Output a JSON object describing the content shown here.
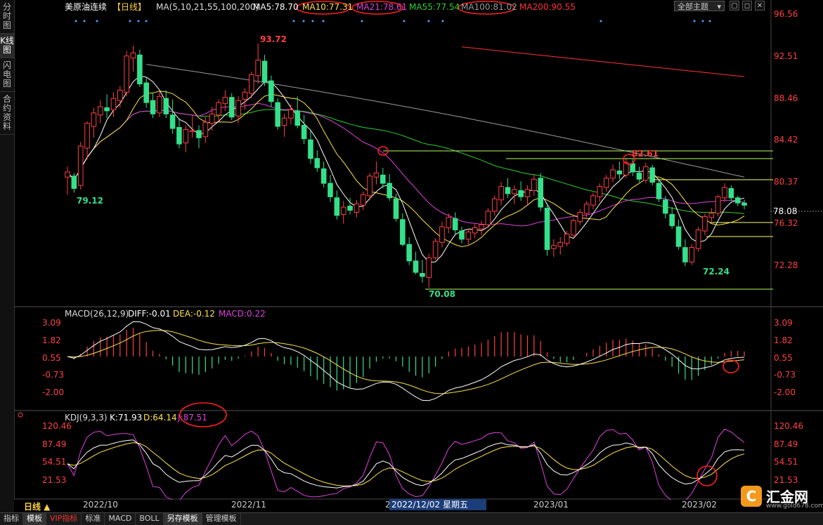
{
  "sidebar": {
    "tabs": [
      "分时图",
      "K线图",
      "闪电图",
      "合约资料"
    ]
  },
  "header": {
    "title": "美原油连续",
    "period_tag": "【日线】",
    "ma_params": "MA(5,10,21,55,100,200)",
    "ma_values": [
      {
        "label": "MA5:78.70",
        "color": "#ffffff"
      },
      {
        "label": "MA10:77.31",
        "color": "#ffe24a"
      },
      {
        "label": "MA21:78.61",
        "color": "#e040e0"
      },
      {
        "label": "MA55:77.54",
        "color": "#30d030"
      },
      {
        "label": "MA100:81.02",
        "color": "#999999"
      },
      {
        "label": "MA200:90.55",
        "color": "#ff3333"
      }
    ],
    "theme_select": "全部主题",
    "window_buttons": [
      "▢",
      "◻",
      "✕"
    ]
  },
  "price_axis": {
    "ticks": [
      "96.56",
      "92.51",
      "88.46",
      "84.42",
      "80.37",
      "76.32",
      "72.28"
    ],
    "current_price": "78.08"
  },
  "annotations": {
    "high_1": "93.72",
    "high_2": "82.61",
    "low_1": "79.12",
    "low_2": "70.08",
    "low_3": "72.24"
  },
  "macd": {
    "params": "MACD(26,12,9)",
    "diff": "DIFF:-0.01",
    "dea": "DEA:-0.12",
    "macd": "MACD:0.22",
    "ticks": [
      "3.09",
      "1.82",
      "0.55",
      "-0.73",
      "-2.00"
    ]
  },
  "kdj": {
    "params": "KDJ(9,3,3)",
    "k": "K:71.93",
    "d": "D:64.14",
    "j": "J:87.51",
    "ticks": [
      "120.46",
      "87.49",
      "54.51",
      "21.53"
    ]
  },
  "time_axis": {
    "period_button": "日线 ▲",
    "labels": [
      "2022/10",
      "2022/11",
      "2022/12/02 星期五",
      "2023/01",
      "2023/02"
    ]
  },
  "bottom_tabs": [
    "指标",
    "模板",
    "VIP指标",
    "标准",
    "MACD",
    "BOLL",
    "另存模板",
    "管理模板"
  ],
  "logo": {
    "name": "汇金网",
    "url": "www.gold678.com"
  },
  "colors": {
    "up": "#ff4040",
    "down": "#35e08a",
    "up_fill": "#000000",
    "ma5": "#ffffff",
    "ma10": "#ffe24a",
    "ma21": "#e040e0",
    "ma55": "#30d030",
    "ma100": "#999999",
    "ma200": "#ff3333",
    "hline_green": "#b0ff60",
    "hline_yellow": "#ffff66",
    "circle": "#ff2020"
  },
  "chart_data": {
    "type": "candlestick",
    "title": "美原油连续",
    "candles": [
      [
        80.8,
        81.8,
        79.1,
        81.3
      ],
      [
        80.9,
        81.2,
        79.3,
        79.7
      ],
      [
        80.0,
        84.2,
        79.6,
        83.8
      ],
      [
        83.6,
        86.2,
        82.5,
        86.0
      ],
      [
        85.7,
        87.5,
        84.6,
        87.0
      ],
      [
        86.8,
        88.2,
        86.0,
        87.6
      ],
      [
        87.5,
        88.8,
        86.5,
        87.2
      ],
      [
        87.3,
        89.0,
        86.6,
        88.4
      ],
      [
        88.2,
        89.6,
        87.5,
        89.2
      ],
      [
        89.0,
        93.0,
        88.6,
        92.5
      ],
      [
        92.3,
        93.5,
        91.0,
        92.8
      ],
      [
        92.6,
        93.1,
        89.5,
        89.8
      ],
      [
        89.9,
        90.5,
        87.5,
        88.0
      ],
      [
        88.2,
        88.9,
        86.5,
        86.9
      ],
      [
        87.0,
        89.1,
        86.6,
        88.6
      ],
      [
        88.4,
        89.2,
        86.5,
        86.9
      ],
      [
        86.8,
        88.3,
        85.0,
        85.5
      ],
      [
        85.6,
        86.5,
        83.6,
        84.0
      ],
      [
        84.1,
        85.8,
        83.2,
        85.4
      ],
      [
        85.2,
        86.8,
        84.6,
        85.3
      ],
      [
        85.3,
        85.8,
        83.6,
        84.6
      ],
      [
        84.7,
        86.6,
        84.1,
        86.1
      ],
      [
        86.0,
        87.6,
        85.3,
        86.9
      ],
      [
        86.8,
        88.3,
        86.2,
        88.0
      ],
      [
        87.9,
        89.2,
        87.2,
        88.5
      ],
      [
        88.5,
        88.9,
        86.3,
        86.6
      ],
      [
        86.7,
        88.6,
        86.0,
        88.2
      ],
      [
        88.3,
        89.4,
        87.3,
        89.0
      ],
      [
        88.9,
        91.0,
        88.4,
        90.7
      ],
      [
        90.6,
        93.7,
        89.8,
        92.1
      ],
      [
        92.0,
        92.6,
        89.6,
        90.0
      ],
      [
        90.1,
        90.6,
        87.6,
        88.1
      ],
      [
        88.0,
        88.4,
        85.4,
        85.7
      ],
      [
        85.8,
        86.9,
        84.7,
        86.5
      ],
      [
        86.5,
        87.8,
        85.9,
        87.3
      ],
      [
        87.2,
        88.6,
        85.5,
        85.8
      ],
      [
        85.8,
        86.8,
        84.0,
        84.5
      ],
      [
        84.4,
        85.3,
        82.1,
        82.6
      ],
      [
        82.6,
        83.4,
        81.3,
        81.7
      ],
      [
        81.6,
        82.3,
        79.8,
        80.2
      ],
      [
        80.2,
        81.0,
        78.4,
        78.9
      ],
      [
        78.8,
        79.5,
        76.7,
        77.1
      ],
      [
        77.2,
        78.5,
        76.3,
        77.9
      ],
      [
        78.0,
        78.8,
        77.2,
        77.6
      ],
      [
        77.4,
        78.6,
        76.9,
        78.2
      ],
      [
        78.1,
        79.4,
        77.6,
        79.1
      ],
      [
        79.0,
        81.2,
        78.6,
        80.9
      ],
      [
        80.8,
        82.3,
        80.1,
        81.2
      ],
      [
        81.0,
        81.7,
        79.7,
        80.2
      ],
      [
        80.2,
        81.1,
        78.5,
        78.8
      ],
      [
        78.7,
        79.2,
        76.5,
        76.8
      ],
      [
        76.7,
        77.3,
        74.1,
        74.3
      ],
      [
        74.3,
        75.0,
        72.3,
        72.7
      ],
      [
        72.7,
        73.6,
        71.4,
        71.6
      ],
      [
        71.5,
        72.8,
        70.6,
        71.2
      ],
      [
        71.1,
        73.4,
        70.1,
        73.0
      ],
      [
        73.0,
        74.9,
        72.8,
        74.6
      ],
      [
        74.5,
        76.5,
        74.0,
        76.0
      ],
      [
        75.9,
        77.3,
        75.4,
        76.9
      ],
      [
        76.8,
        77.4,
        75.3,
        75.7
      ],
      [
        75.6,
        76.0,
        74.4,
        74.8
      ],
      [
        74.8,
        75.8,
        74.2,
        75.5
      ],
      [
        75.4,
        76.3,
        74.9,
        75.9
      ],
      [
        75.8,
        76.6,
        75.2,
        76.2
      ],
      [
        76.2,
        77.8,
        75.9,
        77.5
      ],
      [
        77.5,
        79.0,
        77.1,
        78.7
      ],
      [
        78.6,
        80.3,
        78.1,
        79.9
      ],
      [
        79.8,
        80.7,
        78.8,
        79.2
      ],
      [
        79.2,
        80.0,
        78.2,
        79.6
      ],
      [
        79.5,
        80.4,
        78.5,
        78.9
      ],
      [
        78.9,
        80.0,
        78.1,
        79.6
      ],
      [
        79.5,
        81.0,
        79.0,
        80.6
      ],
      [
        80.7,
        81.2,
        77.5,
        77.9
      ],
      [
        77.8,
        78.3,
        73.2,
        73.8
      ],
      [
        73.9,
        74.8,
        73.1,
        74.2
      ],
      [
        74.1,
        75.0,
        73.3,
        74.5
      ],
      [
        74.4,
        75.6,
        74.1,
        75.3
      ],
      [
        75.2,
        76.8,
        74.9,
        76.6
      ],
      [
        76.5,
        77.7,
        76.2,
        77.4
      ],
      [
        77.3,
        78.5,
        76.9,
        78.2
      ],
      [
        78.1,
        79.3,
        77.7,
        79.0
      ],
      [
        78.9,
        80.2,
        78.4,
        79.9
      ],
      [
        79.8,
        81.0,
        79.4,
        80.7
      ],
      [
        80.7,
        82.0,
        80.3,
        81.5
      ],
      [
        81.4,
        82.3,
        80.6,
        81.1
      ],
      [
        81.0,
        82.6,
        80.7,
        82.2
      ],
      [
        82.1,
        82.5,
        80.9,
        81.3
      ],
      [
        81.2,
        81.8,
        80.3,
        80.6
      ],
      [
        80.5,
        82.2,
        80.2,
        81.8
      ],
      [
        81.7,
        82.0,
        80.0,
        80.3
      ],
      [
        80.2,
        80.6,
        78.4,
        78.7
      ],
      [
        78.6,
        79.0,
        76.8,
        77.3
      ],
      [
        77.2,
        77.9,
        75.8,
        76.1
      ],
      [
        76.0,
        76.7,
        73.8,
        74.1
      ],
      [
        74.0,
        74.8,
        72.2,
        72.6
      ],
      [
        72.6,
        74.3,
        72.3,
        74.0
      ],
      [
        73.9,
        76.0,
        73.6,
        75.7
      ],
      [
        75.6,
        77.3,
        75.2,
        77.0
      ],
      [
        76.9,
        77.8,
        76.5,
        77.3
      ],
      [
        77.3,
        79.1,
        77.0,
        78.9
      ],
      [
        78.8,
        80.2,
        78.4,
        79.8
      ],
      [
        79.7,
        80.0,
        78.5,
        78.8
      ],
      [
        78.8,
        79.0,
        78.0,
        78.3
      ],
      [
        78.3,
        78.6,
        77.7,
        78.08
      ]
    ]
  }
}
